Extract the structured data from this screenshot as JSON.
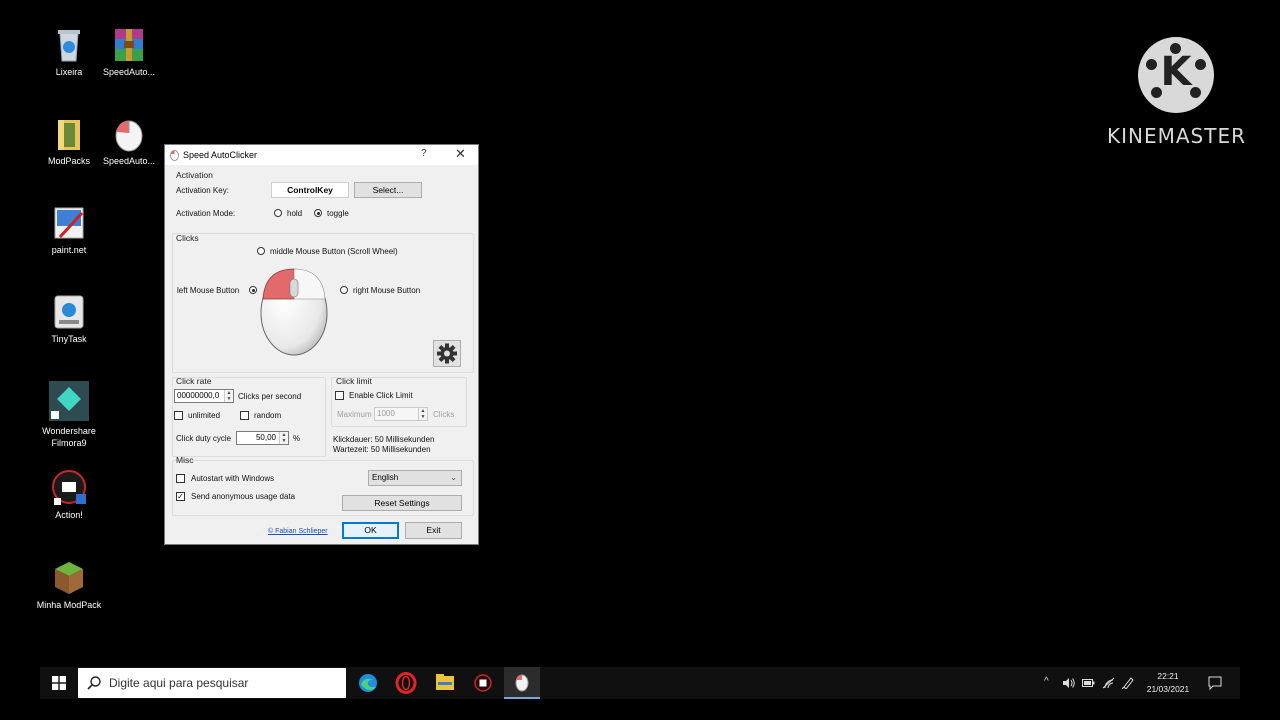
{
  "desktop": {
    "icons": [
      {
        "label": "Lixeira",
        "icon": "recycle-bin-icon"
      },
      {
        "label": "SpeedAuto...",
        "icon": "winrar-archive-icon"
      },
      {
        "label": "ModPacks",
        "icon": "folder-icon"
      },
      {
        "label": "SpeedAuto...",
        "icon": "mouse-icon"
      },
      {
        "label": "paint.net",
        "icon": "paint-net-icon"
      },
      {
        "label": "TinyTask",
        "icon": "tinytask-icon"
      },
      {
        "label": "Wondershare Filmora9",
        "icon": "filmora-icon"
      },
      {
        "label": "Action!",
        "icon": "action-recorder-icon"
      },
      {
        "label": "Minha ModPack",
        "icon": "minecraft-icon"
      }
    ]
  },
  "watermark": {
    "text": "KINEMASTER",
    "logo_letter": "K"
  },
  "window": {
    "title": "Speed AutoClicker",
    "help": "?",
    "close": "✕",
    "activation": {
      "section": "Activation",
      "key_label": "Activation Key:",
      "key_value": "ControlKey",
      "select_button": "Select...",
      "mode_label": "Activation Mode:",
      "mode_hold": "hold",
      "mode_toggle": "toggle",
      "selected_mode": "toggle"
    },
    "clicks": {
      "section": "Clicks",
      "middle": "middle Mouse Button (Scroll Wheel)",
      "left": "left Mouse Button",
      "right": "right Mouse Button",
      "selected": "left"
    },
    "click_rate": {
      "section": "Click rate",
      "value": "00000000,0",
      "unit": "Clicks per second",
      "unlimited": "unlimited",
      "random": "random",
      "duty_label": "Click duty cycle",
      "duty_value": "50,00",
      "duty_unit": "%"
    },
    "click_limit": {
      "section": "Click limit",
      "enable": "Enable Click Limit",
      "max_label": "Maximum",
      "max_value": "1000",
      "unit": "Clicks",
      "info1": "Klickdauer: 50 Millisekunden",
      "info2": "Wartezeit: 50 Millisekunden"
    },
    "misc": {
      "section": "Misc",
      "autostart": "Autostart with Windows",
      "anonymous": "Send anonymous usage data",
      "language": "English",
      "reset": "Reset Settings"
    },
    "footer": {
      "link": "© Fabian Schlieper",
      "ok": "OK",
      "exit": "Exit"
    }
  },
  "taskbar": {
    "search_placeholder": "Digite aqui para pesquisar",
    "time": "22:21",
    "date": "21/03/2021",
    "tray_caret": "^"
  },
  "colors": {
    "accent": "#0078d7",
    "mouse_button": "#e26a6a"
  }
}
